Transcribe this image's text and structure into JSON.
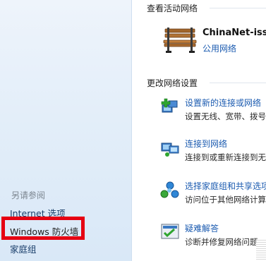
{
  "sidebar": {
    "see_also_heading": "另请参阅",
    "links": {
      "internet_options": "Internet 选项",
      "windows_firewall": "Windows 防火墙",
      "homegroup": "家庭组"
    },
    "highlight_color": "#e60012"
  },
  "active_networks": {
    "heading": "查看活动网络",
    "network_name": "ChinaNet-issb",
    "network_type": "公用网络",
    "icon": "park-bench-icon"
  },
  "change_settings": {
    "heading": "更改网络设置",
    "tasks": [
      {
        "label": "设置新的连接或网络",
        "description": "设置无线、宽带、拨号",
        "icon": "new-connection-icon"
      },
      {
        "label": "连接到网络",
        "description": "连接到或重新连接到无",
        "icon": "connect-network-icon"
      },
      {
        "label": "选择家庭组和共享选项",
        "description": "访问位于其他网络计算",
        "icon": "homegroup-sharing-icon"
      },
      {
        "label": "疑难解答",
        "description": "诊断并修复网络问题",
        "icon": "troubleshoot-icon"
      }
    ]
  },
  "colors": {
    "link": "#1b5bb0",
    "sidebar_bg": "#e3eef9"
  }
}
